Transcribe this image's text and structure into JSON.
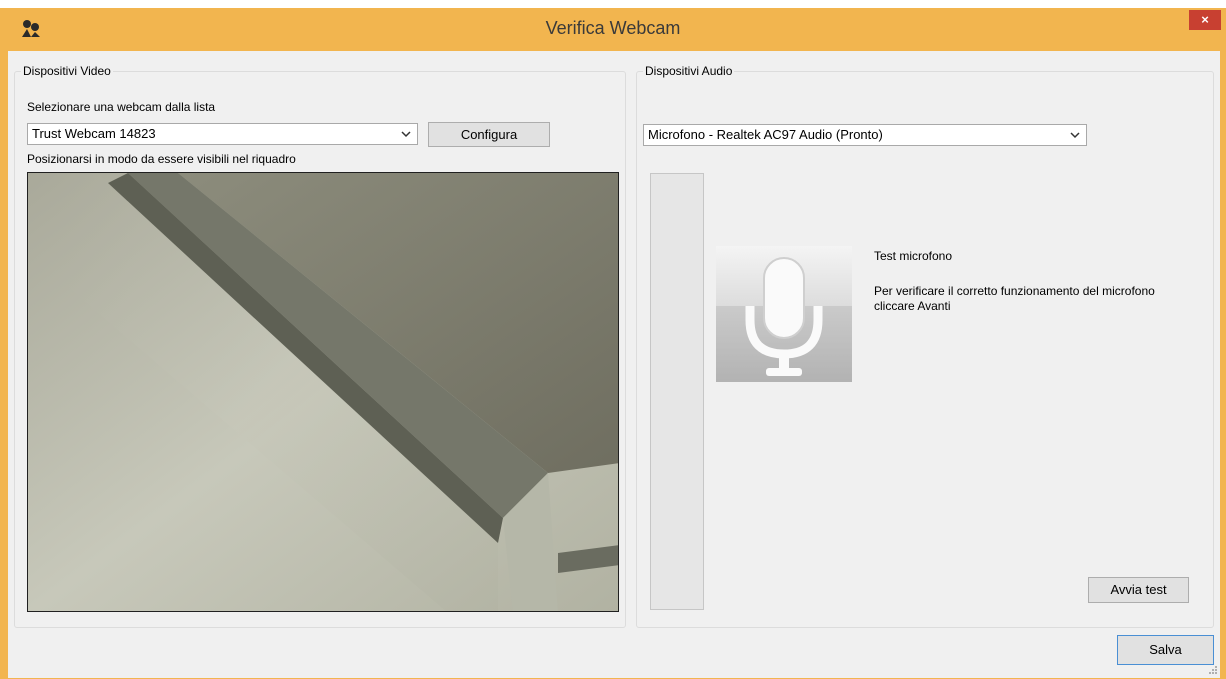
{
  "window": {
    "title": "Verifica Webcam",
    "close_glyph": "×",
    "accent_color": "#f2b54f",
    "close_color": "#c84031"
  },
  "video": {
    "group_label": "Dispositivi Video",
    "select_prompt": "Selezionare una webcam dalla lista",
    "selected_camera": "Trust Webcam 14823",
    "configure_label": "Configura",
    "position_hint": "Posizionarsi in modo da essere visibili nel riquadro"
  },
  "audio": {
    "group_label": "Dispositivi Audio",
    "selected_device": "Microfono - Realtek AC97 Audio (Pronto)",
    "test_title": "Test microfono",
    "test_description": "Per verificare il corretto funzionamento del microfono cliccare Avanti",
    "start_test_label": "Avvia test",
    "icon": "microphone-icon"
  },
  "footer": {
    "save_label": "Salva"
  }
}
